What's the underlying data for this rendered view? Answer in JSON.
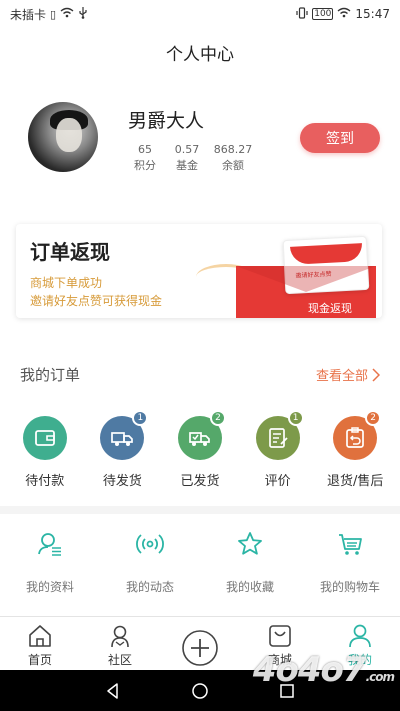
{
  "status_bar": {
    "carrier": "未插卡",
    "battery": "100",
    "time": "15:47"
  },
  "header": {
    "title": "个人中心"
  },
  "profile": {
    "name": "男爵大人",
    "stats": [
      {
        "value": "65",
        "label": "积分"
      },
      {
        "value": "0.57",
        "label": "基金"
      },
      {
        "value": "868.27",
        "label": "余额"
      }
    ],
    "signin_label": "签到"
  },
  "banner": {
    "title": "订单返现",
    "line1": "商城下单成功",
    "line2": "邀请好友点赞可获得现金",
    "card_text": "邀请好友点赞",
    "envelope_label": "现金返现"
  },
  "orders": {
    "title": "我的订单",
    "view_all": "查看全部",
    "items": [
      {
        "label": "待付款",
        "color": "#3fae8f",
        "icon": "wallet-icon",
        "badge": ""
      },
      {
        "label": "待发货",
        "color": "#4f7aa3",
        "icon": "truck-icon",
        "badge": "1"
      },
      {
        "label": "已发货",
        "color": "#55a86a",
        "icon": "delivery-truck-icon",
        "badge": "2"
      },
      {
        "label": "评价",
        "color": "#7d9a4a",
        "icon": "edit-document-icon",
        "badge": "1"
      },
      {
        "label": "退货/售后",
        "color": "#e0713d",
        "icon": "return-icon",
        "badge": "2"
      }
    ]
  },
  "tools": {
    "color": "#2bb5a5",
    "items": [
      {
        "label": "我的资料",
        "icon": "profile-icon"
      },
      {
        "label": "我的动态",
        "icon": "broadcast-icon"
      },
      {
        "label": "我的收藏",
        "icon": "star-icon"
      },
      {
        "label": "我的购物车",
        "icon": "cart-icon"
      }
    ]
  },
  "tabbar": {
    "items": [
      {
        "label": "首页",
        "icon": "home-icon"
      },
      {
        "label": "社区",
        "icon": "community-icon"
      },
      {
        "label": "",
        "icon": "plus-icon"
      },
      {
        "label": "商城",
        "icon": "shop-bag-icon"
      },
      {
        "label": "我的",
        "icon": "person-icon",
        "active": true
      }
    ],
    "active_color": "#2bb5a5"
  },
  "watermark": {
    "main": "4o4o7",
    "suffix": ".com"
  }
}
